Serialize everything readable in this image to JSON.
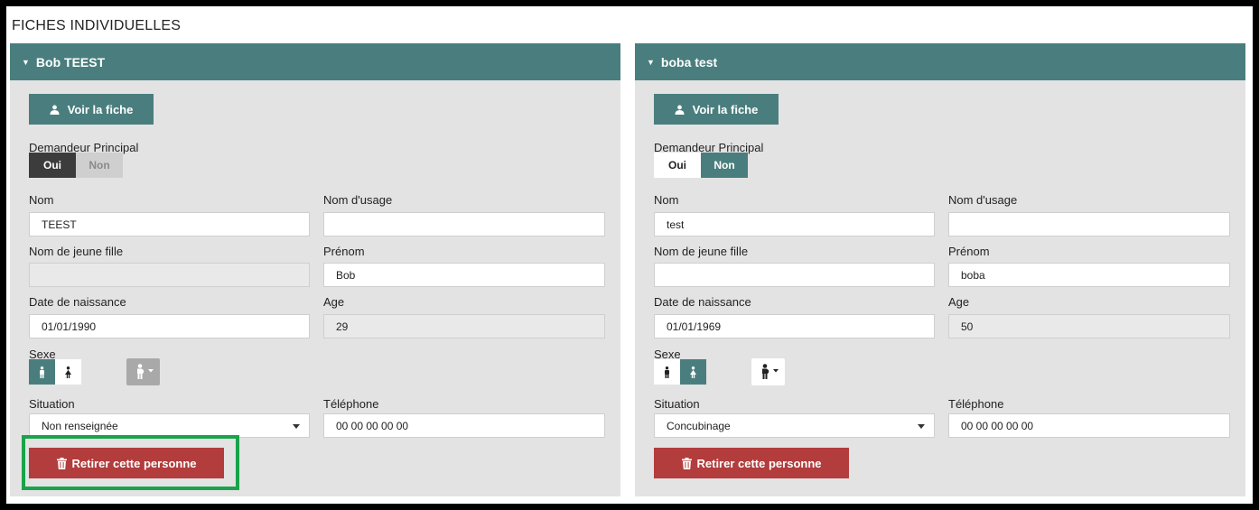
{
  "page_title": "FICHES INDIVIDUELLES",
  "colors": {
    "header_teal": "#4a7e7e",
    "panel_bg": "#e3e3e3",
    "delete_red": "#b33c3c",
    "highlight_green": "#1aa34a"
  },
  "icons": {
    "user": "user-icon",
    "trash": "trash-icon",
    "caret": "caret-down-icon",
    "male": "male-icon",
    "female": "female-icon",
    "pregnant": "pregnant-icon"
  },
  "persons": [
    {
      "header": "Bob TEEST",
      "voir_label": "Voir la fiche",
      "demandeur_label": "Demandeur Principal",
      "demandeur_oui": "Oui",
      "demandeur_non": "Non",
      "demandeur_selected": "Oui",
      "nom_label": "Nom",
      "nom_value": "TEEST",
      "nom_usage_label": "Nom d'usage",
      "nom_usage_value": "",
      "jeune_fille_label": "Nom de jeune fille",
      "jeune_fille_value": "",
      "prenom_label": "Prénom",
      "prenom_value": "Bob",
      "naissance_label": "Date de naissance",
      "naissance_value": "01/01/1990",
      "age_label": "Age",
      "age_value": "29",
      "sexe_label": "Sexe",
      "sexe_selected": "male",
      "situation_label": "Situation",
      "situation_value": "Non renseignée",
      "telephone_label": "Téléphone",
      "telephone_value": "00 00 00 00 00",
      "delete_label": "Retirer cette personne"
    },
    {
      "header": "boba test",
      "voir_label": "Voir la fiche",
      "demandeur_label": "Demandeur Principal",
      "demandeur_oui": "Oui",
      "demandeur_non": "Non",
      "demandeur_selected": "Non",
      "nom_label": "Nom",
      "nom_value": "test",
      "nom_usage_label": "Nom d'usage",
      "nom_usage_value": "",
      "jeune_fille_label": "Nom de jeune fille",
      "jeune_fille_value": "",
      "prenom_label": "Prénom",
      "prenom_value": "boba",
      "naissance_label": "Date de naissance",
      "naissance_value": "01/01/1969",
      "age_label": "Age",
      "age_value": "50",
      "sexe_label": "Sexe",
      "sexe_selected": "female",
      "situation_label": "Situation",
      "situation_value": "Concubinage",
      "telephone_label": "Téléphone",
      "telephone_value": "00 00 00 00 00",
      "delete_label": "Retirer cette personne"
    }
  ]
}
